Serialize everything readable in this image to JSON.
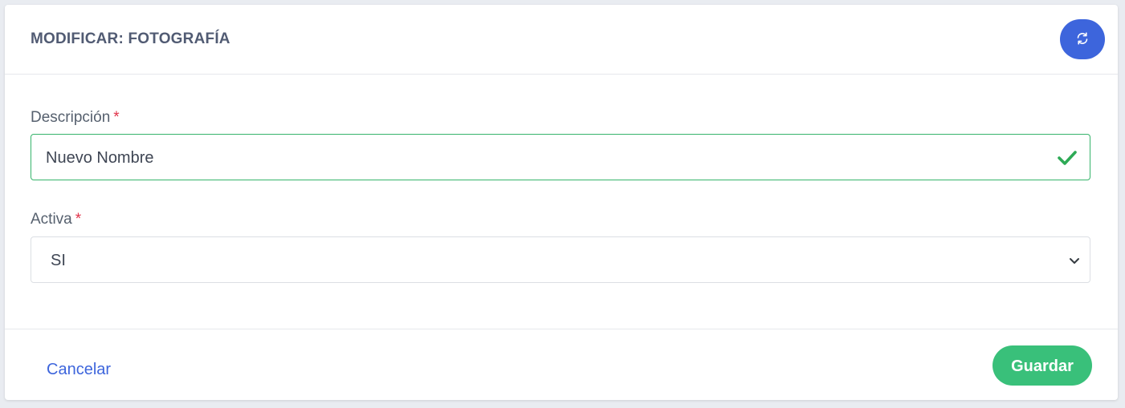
{
  "header": {
    "title": "MODIFICAR: FOTOGRAFÍA",
    "refresh_icon": "refresh-icon"
  },
  "form": {
    "description": {
      "label": "Descripción",
      "required_mark": "*",
      "value": "Nuevo Nombre",
      "status_icon": "check-icon"
    },
    "active": {
      "label": "Activa",
      "required_mark": "*",
      "selected": "SI",
      "dropdown_icon": "chevron-down-icon"
    }
  },
  "footer": {
    "cancel_label": "Cancelar",
    "save_label": "Guardar"
  },
  "colors": {
    "primary": "#3d65dc",
    "success": "#39c07a",
    "valid_border": "#36b46b",
    "required": "#e1334a"
  }
}
